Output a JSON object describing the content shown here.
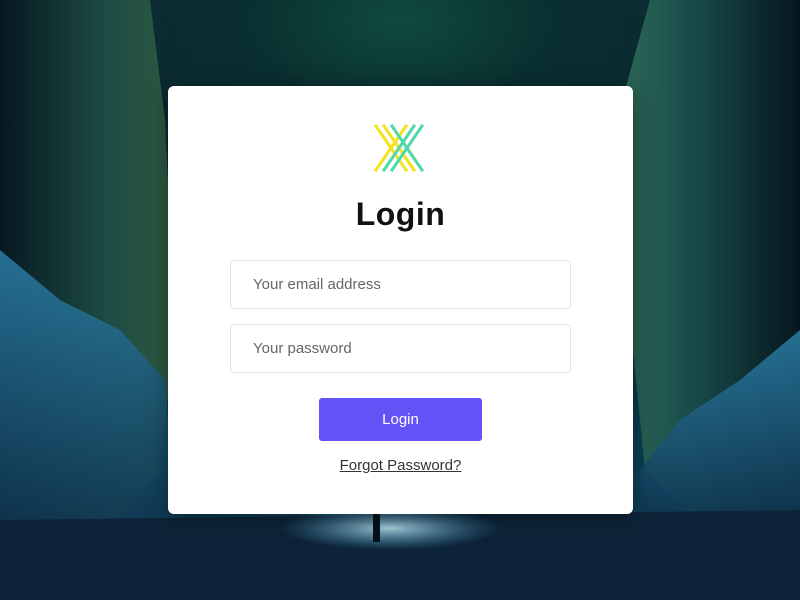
{
  "colors": {
    "accent": "#6352f5",
    "card_background": "#ffffff",
    "logo_yellow": "#f4e21c",
    "logo_green": "#4fd8a8"
  },
  "logo": {
    "icon": "crossed-x-logo-icon"
  },
  "login": {
    "title": "Login",
    "email_placeholder": "Your email address",
    "password_placeholder": "Your password",
    "submit_label": "Login",
    "forgot_label": "Forgot Password?"
  }
}
